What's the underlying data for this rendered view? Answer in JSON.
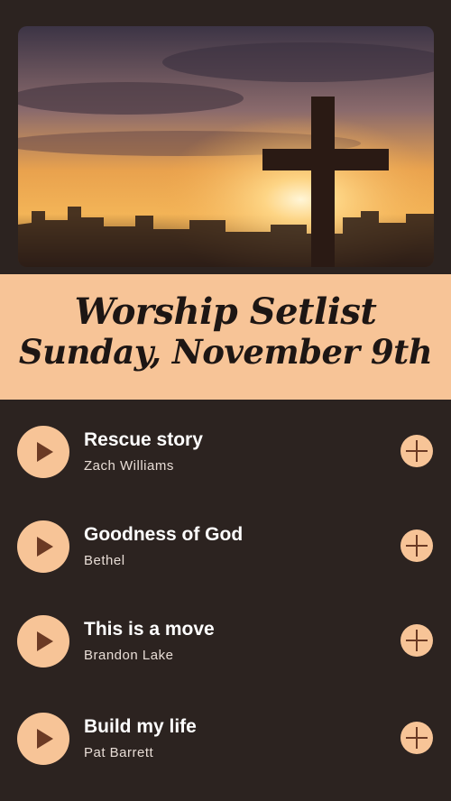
{
  "banner": {
    "title": "Worship Setlist",
    "date": "Sunday, November 9th"
  },
  "songs": [
    {
      "title": "Rescue story",
      "artist": "Zach Williams"
    },
    {
      "title": "Goodness of God",
      "artist": "Bethel"
    },
    {
      "title": "This is a move",
      "artist": "Brandon Lake"
    },
    {
      "title": "Build my life",
      "artist": "Pat Barrett"
    }
  ],
  "colors": {
    "background": "#2c2320",
    "accent": "#f7c497",
    "icon": "#6b3a24"
  }
}
